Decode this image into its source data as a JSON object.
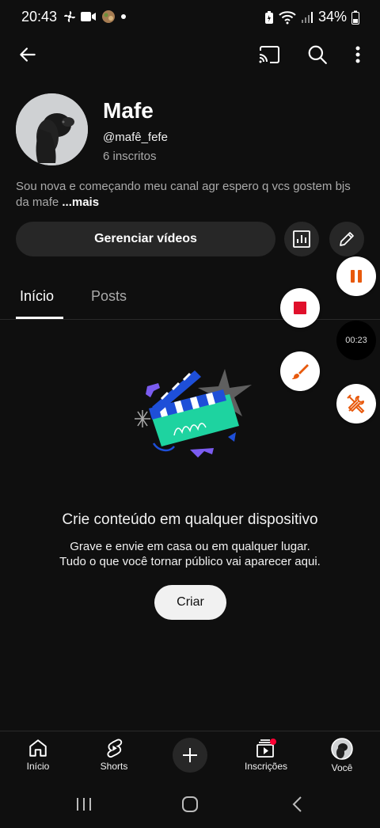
{
  "status": {
    "time": "20:43",
    "battery": "34%"
  },
  "channel": {
    "name": "Mafe",
    "handle": "@mafê_fefe",
    "subscribers": "6 inscritos",
    "description": "Sou nova e começando meu canal agr espero q vcs gostem bjs da mafe",
    "more_label": "...mais"
  },
  "actions": {
    "manage_videos": "Gerenciar vídeos"
  },
  "tabs": [
    {
      "label": "Início",
      "active": true
    },
    {
      "label": "Posts",
      "active": false
    }
  ],
  "empty_state": {
    "title": "Crie conteúdo em qualquer dispositivo",
    "subtitle_line1": "Grave e envie em casa ou em qualquer lugar.",
    "subtitle_line2": "Tudo o que você tornar público vai aparecer aqui.",
    "create_label": "Criar"
  },
  "recorder": {
    "timer": "00:23",
    "accent": "#e8590c"
  },
  "bottom_nav": [
    {
      "label": "Início",
      "icon": "home-icon"
    },
    {
      "label": "Shorts",
      "icon": "shorts-icon"
    },
    {
      "label": "",
      "icon": "plus-icon"
    },
    {
      "label": "Inscrições",
      "icon": "subscriptions-icon"
    },
    {
      "label": "Você",
      "icon": "avatar-icon"
    }
  ],
  "colors": {
    "background": "#0f0f0f",
    "surface": "#272727",
    "record_red": "#e0102b",
    "notification_red": "#ff0033"
  }
}
